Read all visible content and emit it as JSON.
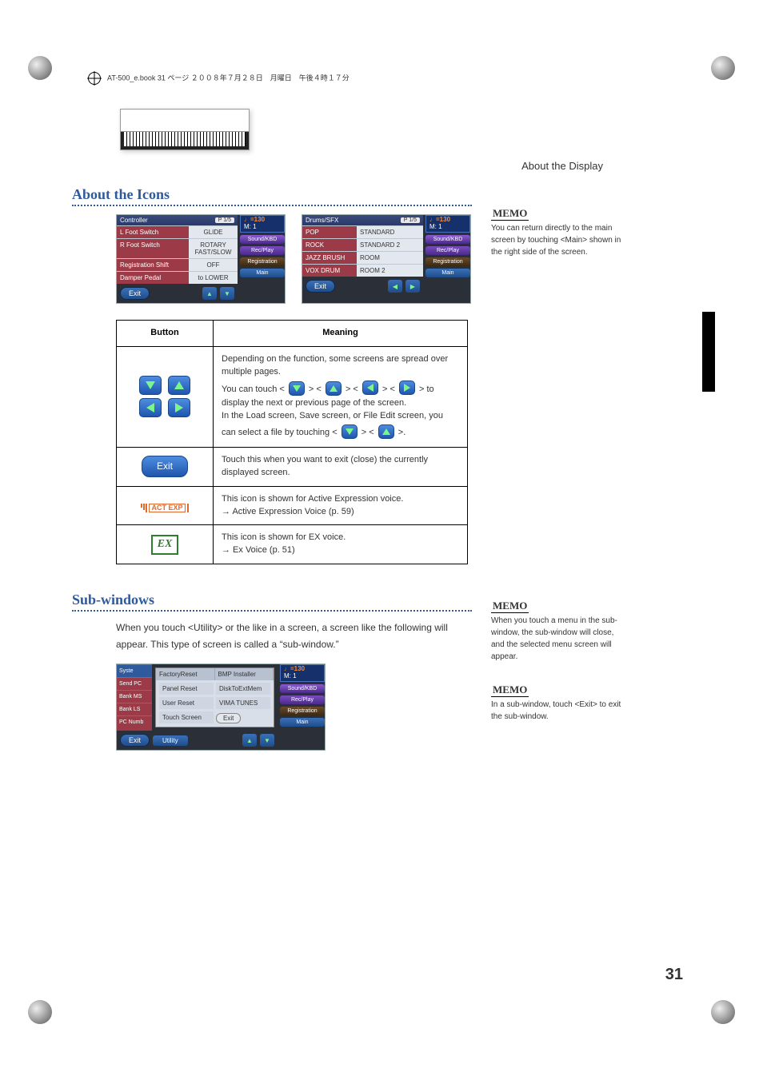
{
  "print_header": "AT-500_e.book  31 ページ  ２００８年７月２８日　月曜日　午後４時１７分",
  "running_head": "About the Display",
  "side_tab": "About the Display",
  "page_number": "31",
  "section_icons_title": "About the Icons",
  "section_subwin_title": "Sub-windows",
  "subwin_intro": "When you touch <Utility> or the like in a screen, a screen like the following will appear. This type of screen is called a “sub-window.”",
  "memo_label": "MEMO",
  "memo1": "You can return directly to the main screen by touching <Main> shown in the right side of the screen.",
  "memo2": "When you touch a menu in the sub-window, the sub-window will close, and the selected menu screen will appear.",
  "memo3": "In a sub-window, touch <Exit> to exit the sub-window.",
  "table": {
    "head_button": "Button",
    "head_meaning": "Meaning",
    "row1_a": "Depending on the function, some screens are spread over multiple pages.",
    "row1_b_pre": "You can touch < ",
    "row1_b_mid1": " > < ",
    "row1_b_mid2": " > < ",
    "row1_b_mid3": " > < ",
    "row1_b_post": " > to display the next or previous page of the screen.",
    "row1_c_pre": "In the Load screen, Save screen, or File Edit screen, you can select a file by touching < ",
    "row1_c_mid": " > < ",
    "row1_c_post": " >.",
    "row2": "Touch this when you want to exit (close) the currently displayed screen.",
    "row3_a": "This icon is shown for Active Expression voice.",
    "row3_b": "→ Active Expression Voice (p. 59)",
    "row4_a": "This icon is shown for EX voice.",
    "row4_b": "→ Ex Voice (p. 51)",
    "exit_label": "Exit",
    "ex_label": "EX",
    "actexp_label": "ACT\nEXP"
  },
  "controller_screen": {
    "title": "Controller",
    "page_badge": "P 1/5",
    "tempo_top": "♩=130",
    "tempo_bottom": "M:   1",
    "rows": [
      {
        "l": "L Foot Switch",
        "r": "GLIDE"
      },
      {
        "l": "R Foot Switch",
        "r": "ROTARY FAST/SLOW"
      },
      {
        "l": "Registration Shift",
        "r": "OFF"
      },
      {
        "l": "Damper Pedal",
        "r": "to LOWER"
      }
    ],
    "exit": "Exit",
    "side": {
      "sound": "Sound/KBD",
      "rec": "Rec/Play",
      "reg": "Registration",
      "main": "Main"
    }
  },
  "drums_screen": {
    "title": "Drums/SFX",
    "page_badge": "P 1/5",
    "tempo_top": "♩=130",
    "tempo_bottom": "M:   1",
    "rows": [
      {
        "l": "POP",
        "r": "STANDARD"
      },
      {
        "l": "ROCK",
        "r": "STANDARD 2"
      },
      {
        "l": "JAZZ BRUSH",
        "r": "ROOM"
      },
      {
        "l": "VOX DRUM",
        "r": "ROOM 2"
      }
    ],
    "exit": "Exit",
    "side": {
      "sound": "Sound/KBD",
      "rec": "Rec/Play",
      "reg": "Registration",
      "main": "Main"
    }
  },
  "subwin_screen": {
    "title": "Syste",
    "tempo_top": "♩=130",
    "tempo_bottom": "M:   1",
    "left_items": [
      "Syste",
      "Send PC",
      "Bank MS",
      "Bank LS",
      "PC Numb"
    ],
    "menu_header": [
      "FactoryReset",
      "BMP Installer"
    ],
    "menu_items": [
      "Panel Reset",
      "DiskToExtMem",
      "User Reset",
      "VIMA TUNES",
      "Touch Screen"
    ],
    "exit_mini": "Exit",
    "footer_exit": "Exit",
    "utility": "Utility",
    "side": {
      "sound": "Sound/KBD",
      "rec": "Rec/Play",
      "reg": "Registration",
      "main": "Main"
    }
  }
}
